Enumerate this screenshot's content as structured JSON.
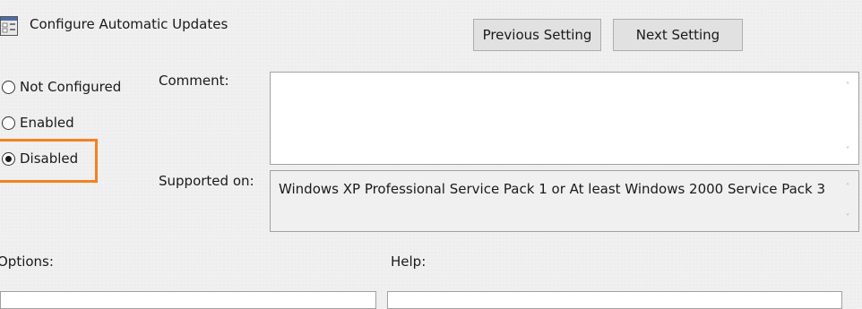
{
  "header": {
    "title": "Configure Automatic Updates",
    "icon": "policy-setting-icon"
  },
  "navigation": {
    "previous_label": "Previous Setting",
    "next_label": "Next Setting"
  },
  "state": {
    "options": [
      {
        "label": "Not Configured",
        "checked": false
      },
      {
        "label": "Enabled",
        "checked": false
      },
      {
        "label": "Disabled",
        "checked": true
      }
    ],
    "highlight_color": "#f48120"
  },
  "comment": {
    "label": "Comment:",
    "value": ""
  },
  "supported": {
    "label": "Supported on:",
    "value": "Windows XP Professional Service Pack 1 or At least Windows 2000 Service Pack 3"
  },
  "panes": {
    "options_label": "Options:",
    "help_label": "Help:"
  }
}
